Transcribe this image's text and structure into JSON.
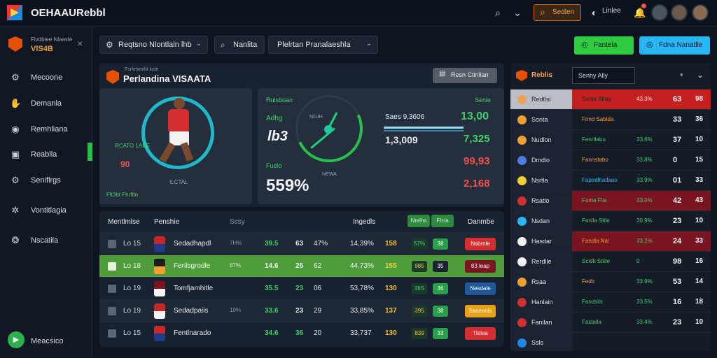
{
  "colors": {
    "accent_orange": "#c8641b",
    "accent_green": "#2ecc40",
    "accent_blue": "#29b6f6",
    "alert_red": "#c42020"
  },
  "header": {
    "app_title": "OEHAAURebbl",
    "search_label": "Sedlen",
    "link_label": "Linlee",
    "icons": [
      "search-icon",
      "chevron-icon",
      "bell-icon",
      "user-icon",
      "avatar",
      "avatar"
    ]
  },
  "sidebar": {
    "team_name": "Flvdbiee Nlaasle",
    "team_score": "VlS4B",
    "close_label": "✕",
    "items": [
      {
        "label": "Mecoone",
        "icon": "network-icon"
      },
      {
        "label": "Demanla",
        "icon": "hand-icon"
      },
      {
        "label": "Remhliana",
        "icon": "camera-icon"
      },
      {
        "label": "Reablla",
        "icon": "book-icon"
      },
      {
        "label": "Seniflrgs",
        "icon": "gear-icon"
      },
      {
        "label": "Vontitlagia",
        "icon": "share-icon"
      },
      {
        "label": "Nscatila",
        "icon": "settings-icon"
      }
    ],
    "bottom_label": "Meacsico"
  },
  "filters": {
    "dd1": "Reqtsno Nlontlaln lhb",
    "dd2": "Nanlita",
    "dd3": "Plelrtan Pranalaeshla",
    "btn_green": "Fantela",
    "btn_blue": "Fdna Nanatlle"
  },
  "panel": {
    "subtitle": "Fsrfelwolbl kale",
    "title": "Perlandina VISAATA",
    "button": "Resn Ctinllan"
  },
  "player_card": {
    "label_top": "RCATO LABE",
    "value": "90",
    "name": "ILCTAL",
    "footer": "Flt3bt Fhrftte"
  },
  "stats": {
    "label_tl": "Rulsboan",
    "label_a": "Adhg",
    "value_a": "lb3",
    "label_tr": "Senle",
    "gauge_top": "NDJH",
    "gauge_bottom": "NEWA",
    "gauge_lbl": "Fuelo",
    "big_pct": "559%",
    "mid_small": "Saes 9,3606",
    "mid_big": "1,3,009",
    "v1": "13,00",
    "v2": "7,325",
    "v3": "99,93",
    "v4": "2,168"
  },
  "table": {
    "headers": [
      "Mentlmlse",
      "Penshie",
      "Sssy",
      "Ingedls",
      "Ntelhs",
      "Ffcla",
      "Danmbe"
    ],
    "rows": [
      {
        "id": "Lo 15",
        "name": "Sedadhapdl",
        "small": "7H%",
        "a": "39.5",
        "b": "63",
        "c": "47%",
        "d": "14,39%",
        "e": "158",
        "pill1": "57%",
        "pill2": "38",
        "status": "Nsbrnle",
        "status_color": "#d32f2f"
      },
      {
        "id": "Lo 18",
        "name": "Ferilsgrodle",
        "small": "87%",
        "a": "14.6",
        "b": "25",
        "c": "62",
        "d": "44,73%",
        "e": "155",
        "pill1": "985",
        "pill2": "35",
        "status": "83 leap",
        "status_color": "#7a1420"
      },
      {
        "id": "Lo 19",
        "name": "Tomfjamhitle",
        "small": "",
        "a": "35.5",
        "b": "23",
        "c": "06",
        "d": "53,78%",
        "e": "130",
        "pill1": "38S",
        "pill2": "36",
        "status": "Nesdale",
        "status_color": "#1e5a9a"
      },
      {
        "id": "Lo 19",
        "name": "Sedadpaiis",
        "small": "19%",
        "a": "33.6",
        "b": "23",
        "c": "29",
        "d": "33,85%",
        "e": "137",
        "pill1": "395",
        "pill2": "38",
        "status": "Ssaeonls",
        "status_color": "#e6a117"
      },
      {
        "id": "Lo 15",
        "name": "Fentlnarado",
        "small": "",
        "a": "34.6",
        "b": "36",
        "c": "20",
        "d": "33,737",
        "e": "130",
        "pill1": "839",
        "pill2": "33",
        "status": "Tlelaa",
        "status_color": "#d32f2f"
      }
    ]
  },
  "right": {
    "head_label": "Reblis",
    "select_value": "Senhy Ally",
    "rows": [
      {
        "name": "Redtlsi",
        "team": "Santa Stlag",
        "pct": "43.3%",
        "n1": "63",
        "n2": "98",
        "ball": "#f2a050"
      },
      {
        "name": "Sonta",
        "team": "Fnnd Sablda",
        "pct": "",
        "n1": "33",
        "n2": "36",
        "ball": "#f0a030"
      },
      {
        "name": "Nudlon",
        "team": "Fenrtlabu",
        "pct": "33.6%",
        "n1": "37",
        "n2": "10",
        "ball": "#f0a030"
      },
      {
        "name": "Dmdio",
        "team": "Fannstabo",
        "pct": "33.8%",
        "n1": "0",
        "n2": "15",
        "ball": "#4c7fe0"
      },
      {
        "name": "Nsrtla",
        "team": "Fapedlhatlaao",
        "pct": "33.9%",
        "n1": "01",
        "n2": "33",
        "ball": "#f0d030"
      },
      {
        "name": "Rsatlo",
        "team": "Fama Flla",
        "pct": "33.0%",
        "n1": "42",
        "n2": "43",
        "ball": "#d32f2f"
      },
      {
        "name": "Nsdan",
        "team": "Fanlla Sltle",
        "pct": "30.9%",
        "n1": "23",
        "n2": "10",
        "ball": "#29b6f6"
      },
      {
        "name": "Hasdar",
        "team": "Fandla Nai",
        "pct": "33.2%",
        "n1": "24",
        "n2": "33",
        "ball": "#f2f2f2"
      },
      {
        "name": "Rerdlle",
        "team": "Scidk Stlde",
        "pct": "0",
        "n1": "98",
        "n2": "16",
        "ball": "#f2f2f2"
      },
      {
        "name": "Rsaa",
        "team": "Fedtr",
        "pct": "33.9%",
        "n1": "53",
        "n2": "14",
        "ball": "#f0a030"
      },
      {
        "name": "Hanlain",
        "team": "Fandsils",
        "pct": "33.5%",
        "n1": "16",
        "n2": "18",
        "ball": "#d32f2f"
      },
      {
        "name": "Fanilan",
        "team": "Fastalla",
        "pct": "33.4%",
        "n1": "23",
        "n2": "10",
        "ball": "#d32f2f"
      },
      {
        "name": "Ssls",
        "team": "",
        "pct": "",
        "n1": "",
        "n2": "",
        "ball": "#1e88e5"
      }
    ]
  }
}
